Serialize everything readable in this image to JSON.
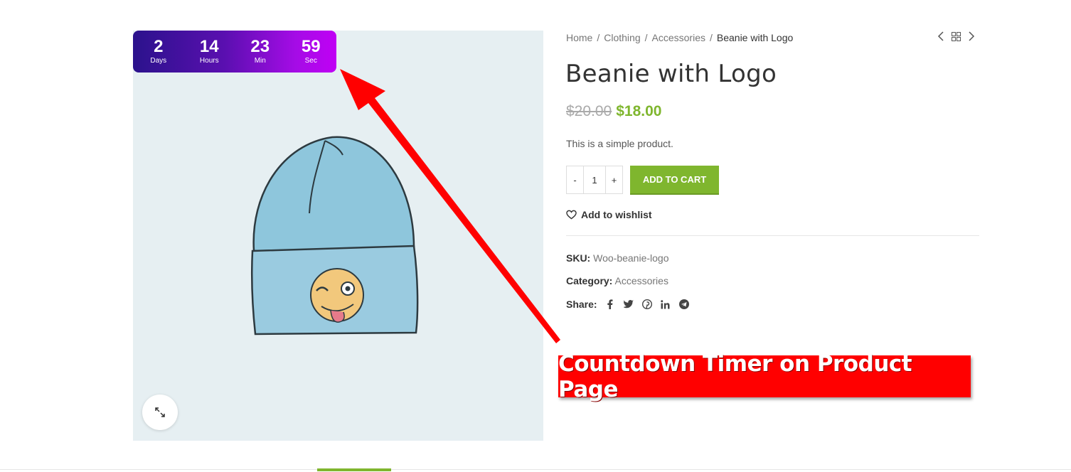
{
  "timer": {
    "units": [
      {
        "value": "2",
        "label": "Days"
      },
      {
        "value": "14",
        "label": "Hours"
      },
      {
        "value": "23",
        "label": "Min"
      },
      {
        "value": "59",
        "label": "Sec"
      }
    ]
  },
  "breadcrumb": {
    "items": [
      "Home",
      "Clothing",
      "Accessories"
    ],
    "current": "Beanie with Logo",
    "separator": "/"
  },
  "product": {
    "title": "Beanie with Logo",
    "old_price": "$20.00",
    "new_price": "$18.00",
    "description": "This is a simple product.",
    "quantity": "1",
    "minus_label": "-",
    "plus_label": "+",
    "add_to_cart_label": "ADD TO CART",
    "wishlist_label": "Add to wishlist",
    "sku_label": "SKU:",
    "sku_value": "Woo-beanie-logo",
    "category_label": "Category:",
    "category_value": "Accessories",
    "share_label": "Share:"
  },
  "social_icons": [
    "facebook-icon",
    "twitter-icon",
    "pinterest-icon",
    "linkedin-icon",
    "telegram-icon"
  ],
  "annotation": {
    "banner_text": "Countdown Timer on Product Page"
  },
  "colors": {
    "accent_green": "#7fb62e",
    "timer_gradient_start": "#2b128c",
    "timer_gradient_end": "#c000f5",
    "banner_red": "#ff0000",
    "image_background": "#e6eff2"
  }
}
